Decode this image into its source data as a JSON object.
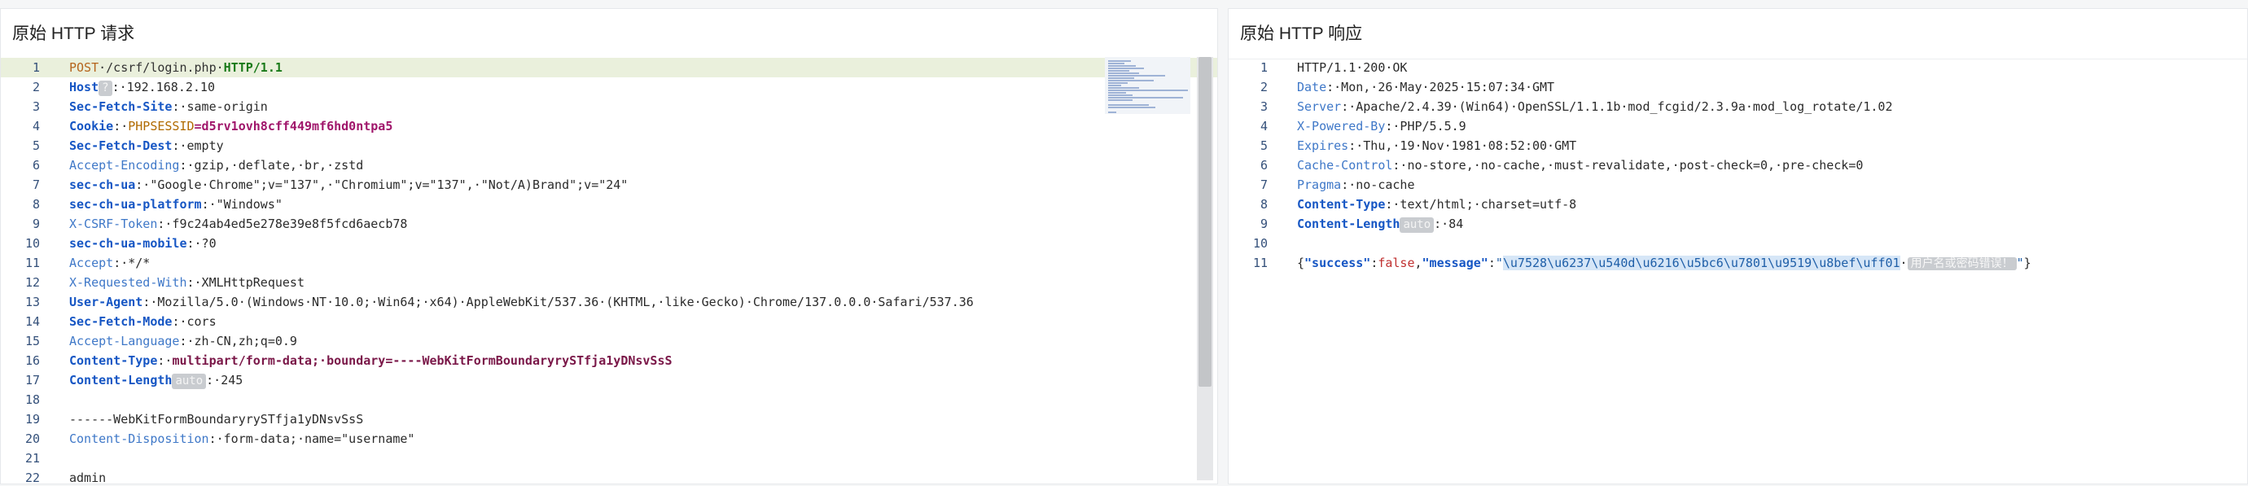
{
  "left": {
    "title": "原始 HTTP 请求",
    "lines": [
      {
        "n": "1",
        "parts": [
          [
            "req-method",
            "POST"
          ],
          [
            "req-path",
            "·/csrf/login.php·"
          ],
          [
            "req-proto",
            "HTTP/1.1"
          ]
        ]
      },
      {
        "n": "2",
        "parts": [
          [
            "h-bold",
            "Host"
          ],
          [
            "chip",
            "?"
          ],
          [
            "v-norm",
            ":·192.168.2.10"
          ]
        ]
      },
      {
        "n": "3",
        "parts": [
          [
            "h-bold",
            "Sec-Fetch-Site"
          ],
          [
            "v-norm",
            ":·same-origin"
          ]
        ]
      },
      {
        "n": "4",
        "parts": [
          [
            "h-bold",
            "Cookie"
          ],
          [
            "v-norm",
            ":·"
          ],
          [
            "v-cookie",
            "PHPSESSID"
          ],
          [
            "v-cookie-val",
            "=d5rv1ovh8cff449mf6hd0ntpa5"
          ]
        ]
      },
      {
        "n": "5",
        "parts": [
          [
            "h-bold",
            "Sec-Fetch-Dest"
          ],
          [
            "v-norm",
            ":·empty"
          ]
        ]
      },
      {
        "n": "6",
        "parts": [
          [
            "h-norm",
            "Accept-Encoding"
          ],
          [
            "v-norm",
            ":·gzip,·deflate,·br,·zstd"
          ]
        ]
      },
      {
        "n": "7",
        "parts": [
          [
            "h-bold",
            "sec-ch-ua"
          ],
          [
            "v-norm",
            ":·\"Google·Chrome\";v=\"137\",·\"Chromium\";v=\"137\",·\"Not/A)Brand\";v=\"24\""
          ]
        ]
      },
      {
        "n": "8",
        "parts": [
          [
            "h-bold",
            "sec-ch-ua-platform"
          ],
          [
            "v-norm",
            ":·\"Windows\""
          ]
        ]
      },
      {
        "n": "9",
        "parts": [
          [
            "h-norm",
            "X-CSRF-Token"
          ],
          [
            "v-norm",
            ":·f9c24ab4ed5e278e39e8f5fcd6aecb78"
          ]
        ]
      },
      {
        "n": "10",
        "parts": [
          [
            "h-bold",
            "sec-ch-ua-mobile"
          ],
          [
            "v-norm",
            ":·?0"
          ]
        ]
      },
      {
        "n": "11",
        "parts": [
          [
            "h-norm",
            "Accept"
          ],
          [
            "v-norm",
            ":·*/*"
          ]
        ]
      },
      {
        "n": "12",
        "parts": [
          [
            "h-norm",
            "X-Requested-With"
          ],
          [
            "v-norm",
            ":·XMLHttpRequest"
          ]
        ]
      },
      {
        "n": "13",
        "parts": [
          [
            "h-bold",
            "User-Agent"
          ],
          [
            "v-norm",
            ":·Mozilla/5.0·(Windows·NT·10.0;·Win64;·x64)·AppleWebKit/537.36·(KHTML,·like·Gecko)·Chrome/137.0.0.0·Safari/537.36"
          ]
        ]
      },
      {
        "n": "14",
        "parts": [
          [
            "h-bold",
            "Sec-Fetch-Mode"
          ],
          [
            "v-norm",
            ":·cors"
          ]
        ]
      },
      {
        "n": "15",
        "parts": [
          [
            "h-norm",
            "Accept-Language"
          ],
          [
            "v-norm",
            ":·zh-CN,zh;q=0.9"
          ]
        ]
      },
      {
        "n": "16",
        "parts": [
          [
            "h-bold",
            "Content-Type"
          ],
          [
            "v-norm",
            ":·"
          ],
          [
            "v-ctype",
            "multipart/form-data;·boundary=----WebKitFormBoundaryrySTfja1yDNsvSsS"
          ]
        ]
      },
      {
        "n": "17",
        "parts": [
          [
            "h-bold",
            "Content-Length"
          ],
          [
            "chip",
            "auto"
          ],
          [
            "v-norm",
            ":·245"
          ]
        ]
      },
      {
        "n": "18",
        "parts": []
      },
      {
        "n": "19",
        "parts": [
          [
            "v-norm",
            "------WebKitFormBoundaryrySTfja1yDNsvSsS"
          ]
        ]
      },
      {
        "n": "20",
        "parts": [
          [
            "h-norm",
            "Content-Disposition"
          ],
          [
            "v-norm",
            ":·form-data;·name=\"username\""
          ]
        ]
      },
      {
        "n": "21",
        "parts": []
      },
      {
        "n": "22",
        "parts": [
          [
            "v-norm",
            "admin"
          ]
        ]
      }
    ]
  },
  "right": {
    "title": "原始 HTTP 响应",
    "lines": [
      {
        "n": "1",
        "parts": [
          [
            "v-norm",
            "HTTP/1.1·200·OK"
          ]
        ]
      },
      {
        "n": "2",
        "parts": [
          [
            "h-norm",
            "Date"
          ],
          [
            "v-norm",
            ":·Mon,·26·May·2025·15:07:34·GMT"
          ]
        ]
      },
      {
        "n": "3",
        "parts": [
          [
            "h-norm",
            "Server"
          ],
          [
            "v-norm",
            ":·Apache/2.4.39·(Win64)·OpenSSL/1.1.1b·mod_fcgid/2.3.9a·mod_log_rotate/1.02"
          ]
        ]
      },
      {
        "n": "4",
        "parts": [
          [
            "h-norm",
            "X-Powered-By"
          ],
          [
            "v-norm",
            ":·PHP/5.5.9"
          ]
        ]
      },
      {
        "n": "5",
        "parts": [
          [
            "h-norm",
            "Expires"
          ],
          [
            "v-norm",
            ":·Thu,·19·Nov·1981·08:52:00·GMT"
          ]
        ]
      },
      {
        "n": "6",
        "parts": [
          [
            "h-norm",
            "Cache-Control"
          ],
          [
            "v-norm",
            ":·no-store,·no-cache,·must-revalidate,·post-check=0,·pre-check=0"
          ]
        ]
      },
      {
        "n": "7",
        "parts": [
          [
            "h-norm",
            "Pragma"
          ],
          [
            "v-norm",
            ":·no-cache"
          ]
        ]
      },
      {
        "n": "8",
        "parts": [
          [
            "h-bold",
            "Content-Type"
          ],
          [
            "v-norm",
            ":·text/html;·charset=utf-8"
          ]
        ]
      },
      {
        "n": "9",
        "parts": [
          [
            "h-bold",
            "Content-Length"
          ],
          [
            "chip",
            "auto"
          ],
          [
            "v-norm",
            ":·84"
          ]
        ]
      },
      {
        "n": "10",
        "parts": []
      },
      {
        "n": "11",
        "parts": [
          [
            "v-norm",
            "{"
          ],
          [
            "json-key",
            "\"success\""
          ],
          [
            "v-norm",
            ":"
          ],
          [
            "json-false",
            "false"
          ],
          [
            "v-norm",
            ","
          ],
          [
            "json-key",
            "\"message\""
          ],
          [
            "v-norm",
            ":"
          ],
          [
            "json-str",
            "\""
          ],
          [
            "json-hl",
            "\\u7528\\u6237\\u540d\\u6216\\u5bc6\\u7801\\u9519\\u8bef\\uff01"
          ],
          [
            "v-norm",
            "·"
          ],
          [
            "json-chip",
            "用户名或密码错误！"
          ],
          [
            "json-str",
            "\""
          ],
          [
            "v-norm",
            "}"
          ]
        ]
      }
    ]
  },
  "colors": {
    "accent": "#1656c4",
    "active_line": "#eaf0dc",
    "chip": "#c9ccd0"
  }
}
